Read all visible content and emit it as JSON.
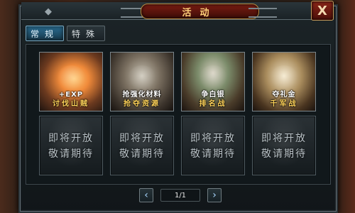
{
  "window": {
    "title": "活动",
    "close_label": "X"
  },
  "tabs": [
    {
      "label": "常规",
      "active": true
    },
    {
      "label": "特殊",
      "active": false
    }
  ],
  "activities": [
    {
      "top_label": "+EXP",
      "bottom_label": "讨伐山贼"
    },
    {
      "top_label": "抢强化材料",
      "bottom_label": "抢夺资源"
    },
    {
      "top_label": "争白银",
      "bottom_label": "排名战"
    },
    {
      "top_label": "夺礼金",
      "bottom_label": "千军战"
    }
  ],
  "coming_soon": [
    {
      "line1": "即将开放",
      "line2": "敬请期待"
    },
    {
      "line1": "即将开放",
      "line2": "敬请期待"
    },
    {
      "line1": "即将开放",
      "line2": "敬请期待"
    },
    {
      "line1": "即将开放",
      "line2": "敬请期待"
    }
  ],
  "pagination": {
    "prev_icon": "chevron-left-icon",
    "next_icon": "chevron-right-icon",
    "page_text": "1/1"
  },
  "colors": {
    "accent_gold": "#ffd35a",
    "title_red": "#7a1c12",
    "active_tab_blue": "#2a6d92"
  }
}
